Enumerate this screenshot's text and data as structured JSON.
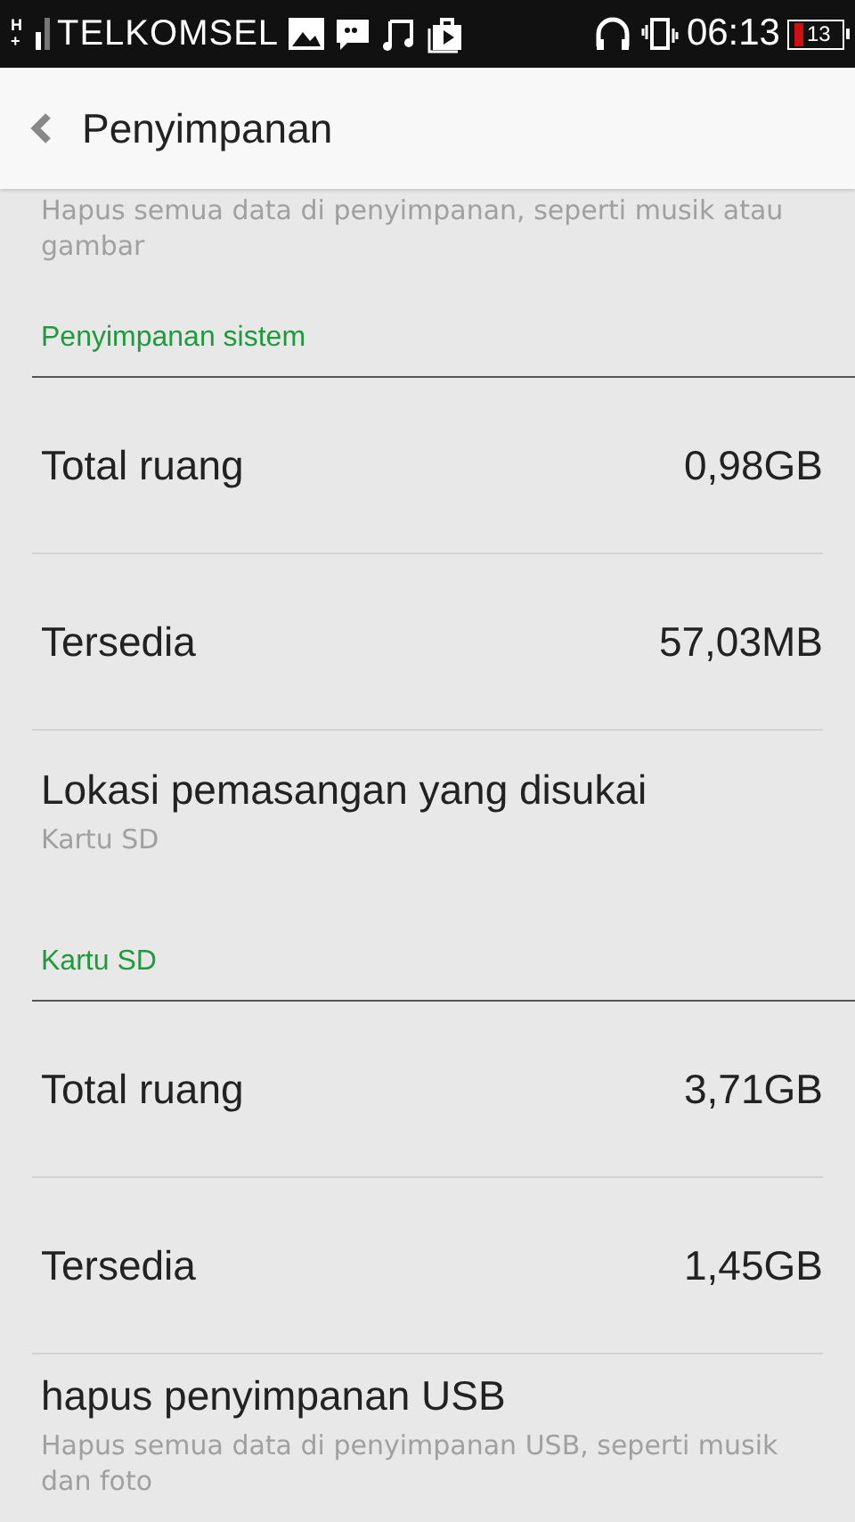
{
  "status_bar": {
    "network": "H+",
    "carrier": "TELKOMSEL",
    "time": "06:13",
    "battery": "13"
  },
  "title_bar": {
    "title": "Penyimpanan"
  },
  "items": [
    {
      "kind": "summary",
      "summary": "Hapus semua data di penyimpanan, seperti musik atau gambar"
    },
    {
      "kind": "header",
      "title": "Penyimpanan sistem"
    },
    {
      "kind": "value",
      "title": "Total ruang",
      "value": "0,98GB"
    },
    {
      "kind": "value",
      "title": "Tersedia",
      "value": "57,03MB"
    },
    {
      "kind": "detail",
      "title": "Lokasi pemasangan yang disukai",
      "summary": "Kartu SD"
    },
    {
      "kind": "header",
      "title": "Kartu SD"
    },
    {
      "kind": "value",
      "title": "Total ruang",
      "value": "3,71GB"
    },
    {
      "kind": "value",
      "title": "Tersedia",
      "value": "1,45GB"
    },
    {
      "kind": "detail",
      "title": "hapus penyimpanan USB",
      "summary": "Hapus semua data di penyimpanan USB, seperti musik dan foto"
    }
  ]
}
